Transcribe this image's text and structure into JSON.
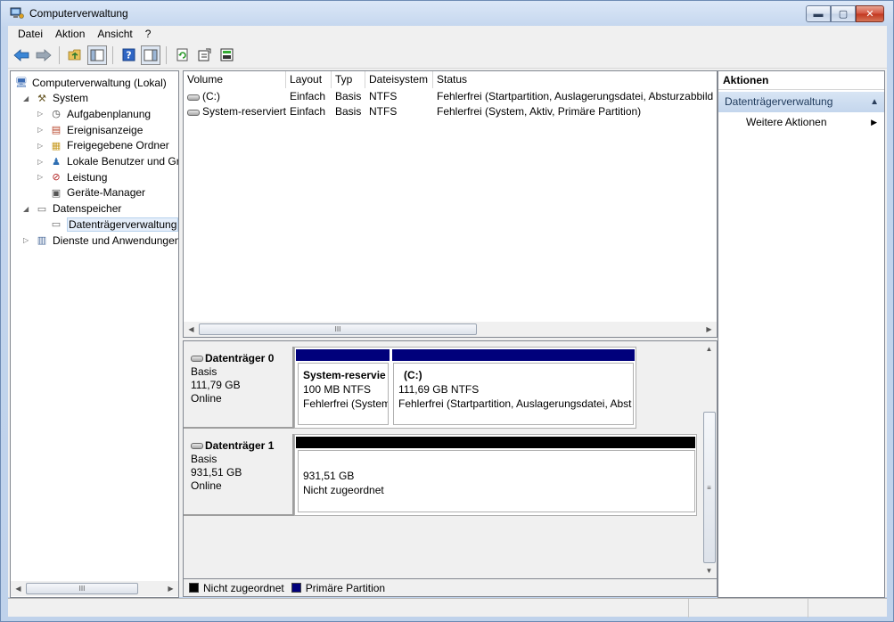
{
  "window": {
    "title": "Computerverwaltung",
    "buttons": [
      "minimize",
      "maximize",
      "close"
    ]
  },
  "menubar": [
    "Datei",
    "Aktion",
    "Ansicht",
    "?"
  ],
  "toolbar": [
    "back-arrow-icon",
    "forward-arrow-icon",
    "up-folder-icon",
    "show-tree-icon",
    "help-icon",
    "show-actions-icon",
    "refresh-icon",
    "properties-icon",
    "export-icon"
  ],
  "tree": {
    "items": [
      {
        "label": "Computerverwaltung (Lokal)",
        "level": 0,
        "expander": "",
        "icon": "computer-icon"
      },
      {
        "label": "System",
        "level": 1,
        "expander": "◢",
        "icon": "tools-icon"
      },
      {
        "label": "Aufgabenplanung",
        "level": 2,
        "expander": "▷",
        "icon": "clock-icon"
      },
      {
        "label": "Ereignisanzeige",
        "level": 2,
        "expander": "▷",
        "icon": "event-viewer-icon"
      },
      {
        "label": "Freigegebene Ordner",
        "level": 2,
        "expander": "▷",
        "icon": "shared-folder-icon"
      },
      {
        "label": "Lokale Benutzer und Gr",
        "level": 2,
        "expander": "▷",
        "icon": "users-icon"
      },
      {
        "label": "Leistung",
        "level": 2,
        "expander": "▷",
        "icon": "performance-icon"
      },
      {
        "label": "Geräte-Manager",
        "level": 2,
        "expander": "",
        "icon": "device-manager-icon"
      },
      {
        "label": "Datenspeicher",
        "level": 1,
        "expander": "◢",
        "icon": "storage-icon"
      },
      {
        "label": "Datenträgerverwaltung",
        "level": 2,
        "expander": "",
        "icon": "disk-management-icon",
        "selected": true
      },
      {
        "label": "Dienste und Anwendungen",
        "level": 1,
        "expander": "▷",
        "icon": "services-icon"
      }
    ]
  },
  "volume_list": {
    "columns": [
      "Volume",
      "Layout",
      "Typ",
      "Dateisystem",
      "Status"
    ],
    "rows": [
      [
        "(C:)",
        "Einfach",
        "Basis",
        "NTFS",
        "Fehlerfrei (Startpartition, Auslagerungsdatei, Absturzabbild"
      ],
      [
        "System-reserviert",
        "Einfach",
        "Basis",
        "NTFS",
        "Fehlerfrei (System, Aktiv, Primäre Partition)"
      ]
    ],
    "scroll_thumb": "III"
  },
  "disks": [
    {
      "name": "Datenträger 0",
      "type": "Basis",
      "size": "111,79 GB",
      "state": "Online",
      "partitions": [
        {
          "name": "System-reservie",
          "size_fs": "100 MB NTFS",
          "status": "Fehlerfrei (System",
          "kind": "primary"
        },
        {
          "name": "(C:)",
          "size_fs": "111,69 GB NTFS",
          "status": "Fehlerfrei (Startpartition, Auslagerungsdatei, Abst",
          "kind": "primary"
        }
      ]
    },
    {
      "name": "Datenträger 1",
      "type": "Basis",
      "size": "931,51 GB",
      "state": "Online",
      "partitions": [
        {
          "name": "",
          "size_fs": "931,51 GB",
          "status": "Nicht zugeordnet",
          "kind": "unallocated"
        }
      ]
    }
  ],
  "legend": [
    {
      "label": "Nicht zugeordnet",
      "color": "#000000"
    },
    {
      "label": "Primäre Partition",
      "color": "#00007b"
    }
  ],
  "actions": {
    "header": "Aktionen",
    "section": "Datenträgerverwaltung",
    "items": [
      "Weitere Aktionen"
    ]
  },
  "colors": {
    "primary_partition": "#00007b",
    "unallocated": "#000000",
    "selection": "#e5eefa"
  }
}
